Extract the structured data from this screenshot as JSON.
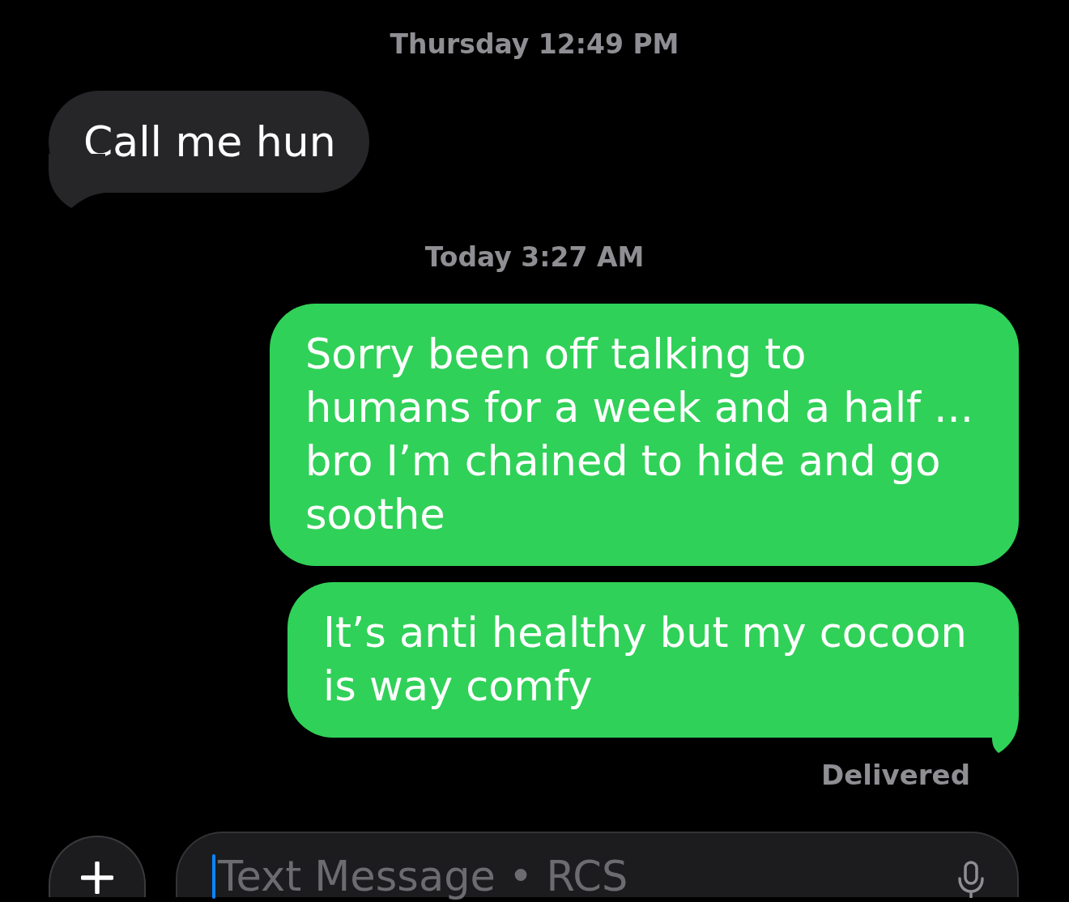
{
  "conversation": [
    {
      "kind": "timestamp",
      "text": "Thursday 12:49 PM"
    },
    {
      "kind": "incoming",
      "text": "Call me hun",
      "tail": true
    },
    {
      "kind": "timestamp",
      "text": "Today 3:27 AM"
    },
    {
      "kind": "outgoing",
      "text": "Sorry been off talking to humans for a week and a half ... bro I’m chained to hide and go soothe",
      "tail": false
    },
    {
      "kind": "outgoing",
      "text": "It’s anti healthy but my cocoon is way comfy",
      "tail": true
    },
    {
      "kind": "status",
      "text": "Delivered"
    }
  ],
  "composer": {
    "placeholder": "Text Message • RCS",
    "focused": true
  }
}
